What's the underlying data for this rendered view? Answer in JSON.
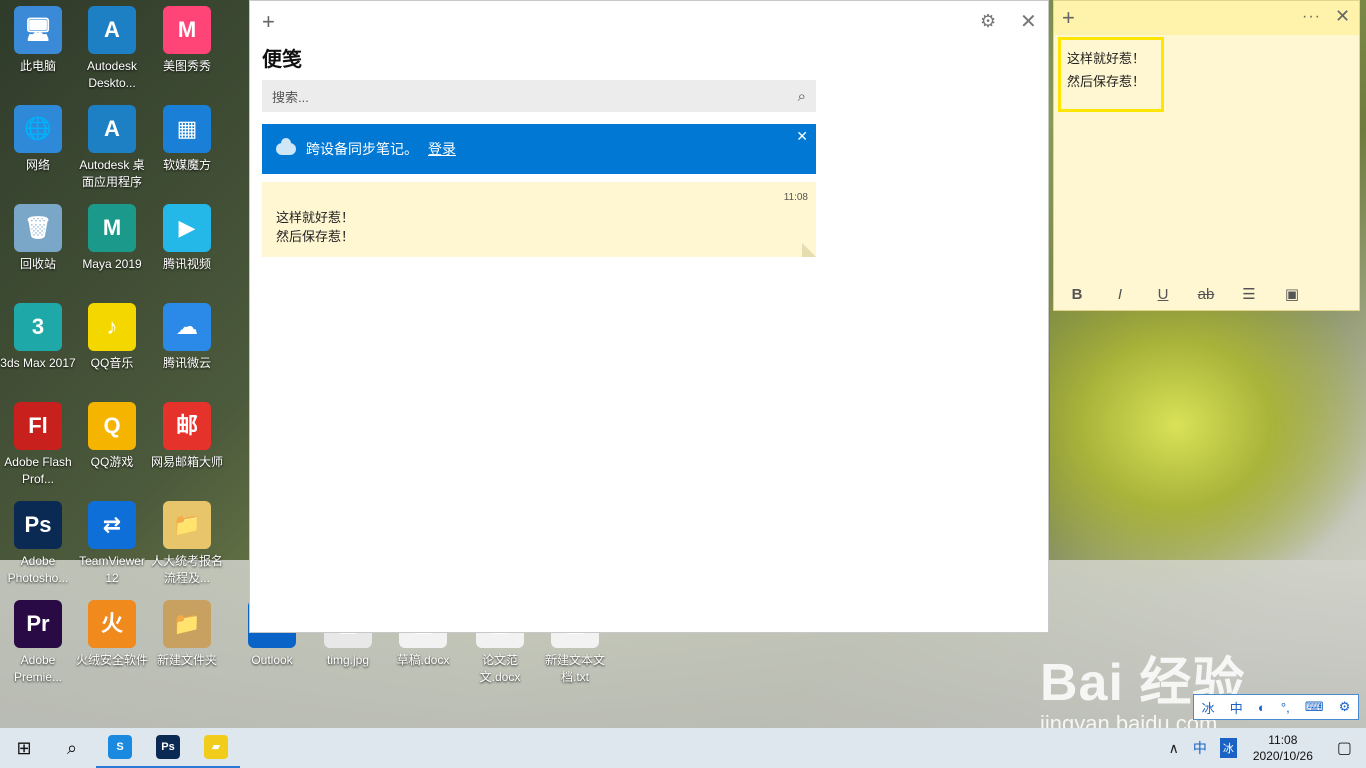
{
  "desktop_icons": [
    {
      "label": "此电脑",
      "glyph": "🖥",
      "color": "#3a8ad8"
    },
    {
      "label": "Autodesk Deskto...",
      "glyph": "A",
      "color": "#1d7fc4"
    },
    {
      "label": "美图秀秀",
      "glyph": "M",
      "color": "#ff4477"
    },
    {
      "label": "网络",
      "glyph": "🌐",
      "color": "#2e8ad8"
    },
    {
      "label": "Autodesk 桌面应用程序",
      "glyph": "A",
      "color": "#1d7fc4"
    },
    {
      "label": "软媒魔方",
      "glyph": "▦",
      "color": "#1a7fd6"
    },
    {
      "label": "回收站",
      "glyph": "🗑",
      "color": "#7aa7c8"
    },
    {
      "label": "Maya 2019",
      "glyph": "M",
      "color": "#1b9a8c"
    },
    {
      "label": "腾讯视频",
      "glyph": "▶",
      "color": "#23b8e8"
    },
    {
      "label": "3ds Max 2017",
      "glyph": "3",
      "color": "#1fa8a8"
    },
    {
      "label": "QQ音乐",
      "glyph": "♪",
      "color": "#f5d700"
    },
    {
      "label": "腾讯微云",
      "glyph": "☁",
      "color": "#2b8ae8"
    },
    {
      "label": "Adobe Flash Prof...",
      "glyph": "Fl",
      "color": "#c8201c"
    },
    {
      "label": "QQ游戏",
      "glyph": "Q",
      "color": "#f5b400"
    },
    {
      "label": "网易邮箱大师",
      "glyph": "邮",
      "color": "#e5322b"
    },
    {
      "label": "Adobe Photosho...",
      "glyph": "Ps",
      "color": "#0b2a53"
    },
    {
      "label": "TeamViewer 12",
      "glyph": "⇄",
      "color": "#0e6fd8"
    },
    {
      "label": "人大统考报名流程及...",
      "glyph": "📁",
      "color": "#e8c56a"
    },
    {
      "label": "Adobe Premie...",
      "glyph": "Pr",
      "color": "#2a0a45"
    },
    {
      "label": "火绒安全软件",
      "glyph": "火",
      "color": "#f08a1c"
    },
    {
      "label": "新建文件夹",
      "glyph": "📁",
      "color": "#c8a060"
    },
    {
      "label": "Outlook",
      "glyph": "O",
      "color": "#0a64c8"
    },
    {
      "label": "timg.jpg",
      "glyph": "▤",
      "color": "#e8e8e8"
    },
    {
      "label": "草稿.docx",
      "glyph": "▤",
      "color": "#f2f2f2"
    },
    {
      "label": "论文范文.docx",
      "glyph": "▤",
      "color": "#f2f2f2"
    },
    {
      "label": "新建文本文档.txt",
      "glyph": "▤",
      "color": "#f2f2f2"
    }
  ],
  "notes_window": {
    "add_glyph": "+",
    "settings_glyph": "⚙",
    "close_glyph": "✕",
    "title": "便笺",
    "search_placeholder": "搜索...",
    "search_glyph": "⌕",
    "banner_text": "跨设备同步笔记。",
    "banner_link": "登录",
    "banner_close": "✕",
    "note": {
      "time": "11:08",
      "text": "这样就好惹！\n然后保存惹！"
    }
  },
  "sticky_note": {
    "add_glyph": "+",
    "more_glyph": "···",
    "close_glyph": "✕",
    "text": "这样就好惹！\n然后保存惹！",
    "toolbar": {
      "bold": "B",
      "italic": "I",
      "underline": "U",
      "strike": "ab",
      "list": "☰",
      "image": "▣"
    }
  },
  "ime_bar": [
    "冰",
    "中",
    "◐",
    "°,",
    "⌨",
    "⚙"
  ],
  "watermark": {
    "brand": "Bai 经验",
    "url": "jingyan.baidu.com"
  },
  "taskbar": {
    "start_glyph": "⊞",
    "search_glyph": "⌕",
    "apps": [
      {
        "name": "sogou-browser",
        "glyph": "S",
        "color": "#1a8ae0"
      },
      {
        "name": "photoshop",
        "glyph": "Ps",
        "color": "#0b2a53"
      },
      {
        "name": "sticky-notes",
        "glyph": "▰",
        "color": "#f2cc1a"
      }
    ],
    "tray_chevron": "∧",
    "ime_lang": "中",
    "ime_icon": "冰",
    "time": "11:08",
    "date": "2020/10/26",
    "notification_glyph": "▢"
  }
}
